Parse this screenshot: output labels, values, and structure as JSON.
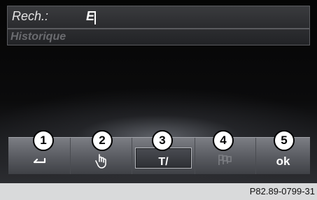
{
  "search": {
    "label": "Rech.:",
    "value": "E"
  },
  "history": {
    "label": "Historique"
  },
  "toolbar": {
    "buttons": [
      {
        "callout": "1",
        "glyph": "↩",
        "icon": "back-arrow-icon",
        "dim": false
      },
      {
        "callout": "2",
        "glyph": "",
        "icon": "handwriting-icon",
        "dim": false
      },
      {
        "callout": "3",
        "glyph": "T/",
        "icon": "text-input-mode-icon",
        "dim": false,
        "selected": true
      },
      {
        "callout": "4",
        "glyph": "",
        "icon": "flags-language-icon",
        "dim": true
      },
      {
        "callout": "5",
        "glyph": "ok",
        "icon": "ok-icon",
        "dim": false
      }
    ]
  },
  "caption": "P82.89-0799-31"
}
